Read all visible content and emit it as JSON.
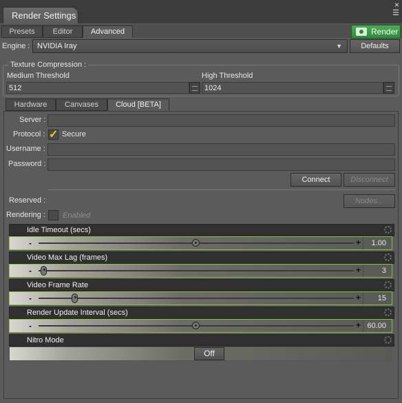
{
  "window": {
    "title": "Render Settings",
    "close_glyph": "×",
    "menu_glyph": "☰"
  },
  "tabs": [
    "Presets",
    "Editor",
    "Advanced"
  ],
  "render_button": {
    "label": "Render",
    "color": "#3c9a48"
  },
  "engine": {
    "label": "Engine :",
    "value": "NVIDIA Iray",
    "defaults_label": "Defaults"
  },
  "texture": {
    "group_title": "Texture Compression :",
    "medium_label": "Medium Threshold",
    "medium_value": "512",
    "high_label": "High Threshold",
    "high_value": "1024"
  },
  "subtabs": [
    "Hardware",
    "Canvases",
    "Cloud [BETA]"
  ],
  "cloud": {
    "server_label": "Server :",
    "server_value": "",
    "protocol_label": "Protocol :",
    "secure_label": "Secure",
    "secure_checked": true,
    "username_label": "Username :",
    "username_value": "",
    "password_label": "Password :",
    "password_value": "",
    "connect_label": "Connect",
    "disconnect_label": "Disconnect",
    "reserved_label": "Reserved :",
    "nodes_label": "Nodes...",
    "rendering_label": "Rendering :",
    "enabled_label": "Enabled"
  },
  "sliders": [
    {
      "name": "Idle Timeout (secs)",
      "value": "1.00",
      "level": 0.5
    },
    {
      "name": "Video Max Lag (frames)",
      "value": "3",
      "level": 0.02
    },
    {
      "name": "Video Frame Rate",
      "value": "15",
      "level": 0.12
    },
    {
      "name": "Render Update Interval (secs)",
      "value": "60.00",
      "level": 0.5
    }
  ],
  "nitro": {
    "name": "Nitro Mode",
    "value": "Off"
  },
  "colors": {
    "accent_green": "#8fbf3f",
    "check_yellow": "#f5c518"
  }
}
